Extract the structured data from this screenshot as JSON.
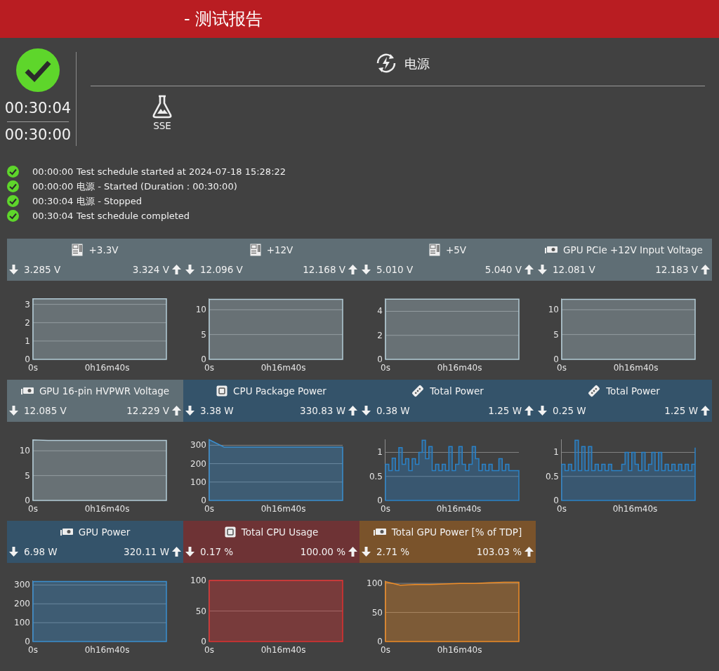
{
  "window": {
    "title": "- 测试报告"
  },
  "summary": {
    "passed": true,
    "elapsed": "00:30:04",
    "duration": "00:30:00"
  },
  "test": {
    "name": "电源"
  },
  "tests": [
    {
      "name": "SSE"
    }
  ],
  "log": [
    {
      "time": "00:00:00",
      "message": "Test schedule started at 2024-07-18 15:28:22"
    },
    {
      "time": "00:00:00",
      "message": "电源 - Started (Duration : 00:30:00)"
    },
    {
      "time": "00:30:04",
      "message": "电源 - Stopped"
    },
    {
      "time": "00:30:04",
      "message": "Test schedule completed"
    }
  ],
  "sensors": [
    {
      "kind": "board",
      "name": "+3.3V",
      "color": "#5f6e75",
      "min": "3.285 V",
      "max": "3.324 V",
      "chart_data": {
        "type": "area",
        "grid": true,
        "categories": [
          "0s",
          null,
          null,
          null,
          null,
          "0h16m40s",
          null,
          null,
          null,
          null
        ],
        "series": [
          {
            "color": "#b3cbd6",
            "values": [
              3.3,
              3.3,
              3.3,
              3.3,
              3.3,
              3.3,
              3.3,
              3.3,
              3.3,
              3.3
            ]
          }
        ],
        "ylim": [
          0,
          3.33
        ],
        "yticks": [
          0,
          1,
          2,
          3
        ]
      }
    },
    {
      "kind": "board",
      "name": "+12V",
      "color": "#5f6e75",
      "min": "12.096 V",
      "max": "12.168 V",
      "chart_data": {
        "type": "area",
        "grid": true,
        "categories": [
          "0s",
          null,
          null,
          null,
          null,
          "0h16m40s",
          null,
          null,
          null,
          null
        ],
        "series": [
          {
            "color": "#b3cbd6",
            "values": [
              12.1,
              12.1,
              12.1,
              12.1,
              12.1,
              12.1,
              12.1,
              12.1,
              12.1,
              12.1
            ]
          }
        ],
        "ylim": [
          0,
          12.3
        ],
        "yticks": [
          0,
          5,
          10
        ]
      }
    },
    {
      "kind": "board",
      "name": "+5V",
      "color": "#5f6e75",
      "min": "5.010 V",
      "max": "5.040 V",
      "chart_data": {
        "type": "area",
        "grid": true,
        "categories": [
          "0s",
          null,
          null,
          null,
          null,
          "0h16m40s",
          null,
          null,
          null,
          null
        ],
        "series": [
          {
            "color": "#b3cbd6",
            "values": [
              5.0,
              5.0,
              5.0,
              5.0,
              5.0,
              5.0,
              5.0,
              5.0,
              5.0,
              5.0
            ]
          }
        ],
        "ylim": [
          0,
          5.08
        ],
        "yticks": [
          0,
          2,
          4
        ]
      }
    },
    {
      "kind": "gpu",
      "name": "GPU PCIe +12V Input Voltage",
      "color": "#5f6e75",
      "min": "12.081 V",
      "max": "12.183 V",
      "chart_data": {
        "type": "area",
        "grid": true,
        "categories": [
          "0s",
          null,
          null,
          null,
          null,
          "0h16m40s",
          null,
          null,
          null,
          null
        ],
        "series": [
          {
            "color": "#b3cbd6",
            "values": [
              12.1,
              12.1,
              12.1,
              12.1,
              12.1,
              12.1,
              12.1,
              12.1,
              12.1,
              12.1
            ]
          }
        ],
        "ylim": [
          0,
          12.3
        ],
        "yticks": [
          0,
          5,
          10
        ]
      }
    },
    {
      "kind": "gpu",
      "name": "GPU 16-pin HVPWR Voltage",
      "color": "#5f6e75",
      "min": "12.085 V",
      "max": "12.229 V",
      "chart_data": {
        "type": "area",
        "grid": true,
        "categories": [
          "0s",
          null,
          null,
          null,
          null,
          "0h16m40s",
          null,
          null,
          null,
          null
        ],
        "series": [
          {
            "color": "#b3cbd6",
            "values": [
              12.2,
              12.1,
              12.1,
              12.1,
              12.1,
              12.1,
              12.1,
              12.1,
              12.1,
              12.1
            ]
          }
        ],
        "ylim": [
          0,
          12.3
        ],
        "yticks": [
          0,
          5,
          10
        ]
      }
    },
    {
      "kind": "cpu",
      "name": "CPU Package Power",
      "color": "#34536a",
      "min": "3.38 W",
      "max": "330.83 W",
      "chart_data": {
        "type": "area",
        "grid": true,
        "categories": [
          "0s",
          null,
          null,
          null,
          null,
          "0h16m40s",
          null,
          null,
          null,
          null
        ],
        "series": [
          {
            "color": "#3a8fd0",
            "values": [
              330,
              290,
              290,
              290,
              290,
              290,
              290,
              290,
              290,
              290
            ]
          }
        ],
        "ylim": [
          0,
          332
        ],
        "yticks": [
          0,
          100,
          200,
          300
        ]
      }
    },
    {
      "kind": "battery",
      "name": "Total Power",
      "color": "#34536a",
      "min": "0.38 W",
      "max": "1.25 W",
      "chart_data": {
        "type": "area",
        "grid": true,
        "categories": [
          "0s",
          null,
          null,
          null,
          null,
          null,
          null,
          null,
          null,
          null,
          null,
          null,
          null,
          null,
          null,
          null,
          null,
          null,
          null,
          null,
          null,
          null,
          "0h16m40s",
          null,
          null,
          null,
          null,
          null,
          null,
          null,
          null,
          null,
          null,
          null,
          null,
          null,
          null,
          null,
          null,
          null,
          null
        ],
        "series": [
          {
            "color": "#2a82c8",
            "values": [
              0.75,
              0.62,
              0.88,
              0.62,
              1.1,
              0.75,
              0.87,
              0.62,
              0.87,
              0.75,
              1.0,
              1.25,
              0.87,
              1.12,
              0.62,
              0.75,
              0.62,
              0.75,
              0.62,
              1.12,
              0.62,
              0.75,
              1.12,
              0.75,
              0.62,
              0.75,
              1.12,
              0.87,
              0.62,
              0.75,
              0.62,
              0.75,
              0.62,
              0.62,
              0.87,
              0.62,
              0.75,
              0.62,
              0.62,
              0.62,
              0.62
            ]
          }
        ],
        "ylim": [
          0,
          1.27
        ],
        "yticks": [
          0,
          0.5,
          1
        ]
      }
    },
    {
      "kind": "battery",
      "name": "Total Power",
      "color": "#34536a",
      "min": "0.25 W",
      "max": "1.25 W",
      "chart_data": {
        "type": "area",
        "grid": true,
        "categories": [
          "0s",
          null,
          null,
          null,
          null,
          null,
          null,
          null,
          null,
          null,
          null,
          null,
          null,
          null,
          null,
          null,
          null,
          null,
          null,
          null,
          null,
          null,
          "0h16m40s",
          null,
          null,
          null,
          null,
          null,
          null,
          null,
          null,
          null,
          null,
          null,
          null,
          null,
          null,
          null,
          null,
          null,
          null
        ],
        "series": [
          {
            "color": "#2a82c8",
            "values": [
              0.75,
              0.62,
              0.75,
              0.62,
              1.25,
              0.62,
              1.12,
              0.62,
              1.12,
              0.62,
              0.75,
              0.62,
              0.75,
              0.62,
              0.75,
              0.62,
              0.62,
              0.62,
              0.75,
              1.0,
              0.62,
              1.0,
              0.75,
              0.62,
              1.0,
              0.62,
              0.75,
              1.0,
              0.62,
              1.0,
              0.62,
              0.75,
              0.62,
              0.75,
              0.62,
              0.75,
              0.62,
              0.75,
              0.62,
              0.75,
              1.1
            ]
          }
        ],
        "ylim": [
          0,
          1.27
        ],
        "yticks": [
          0,
          0.5,
          1
        ]
      }
    },
    {
      "kind": "gpu",
      "name": "GPU Power",
      "color": "#34536a",
      "min": "6.98 W",
      "max": "320.11 W",
      "chart_data": {
        "type": "area",
        "grid": true,
        "categories": [
          "0s",
          null,
          null,
          null,
          null,
          "0h16m40s",
          null,
          null,
          null,
          null
        ],
        "series": [
          {
            "color": "#3a8fd0",
            "values": [
              318,
              318,
              318,
              318,
              318,
              318,
              318,
              318,
              318,
              318
            ]
          }
        ],
        "ylim": [
          0,
          324
        ],
        "yticks": [
          0,
          100,
          200,
          300
        ]
      }
    },
    {
      "kind": "cpu",
      "name": "Total CPU Usage",
      "color": "#6e3335",
      "min": "0.17 %",
      "max": "100.00 %",
      "chart_data": {
        "type": "area",
        "grid": true,
        "categories": [
          "0s",
          null,
          null,
          null,
          null,
          "0h16m40s",
          null,
          null,
          null,
          null
        ],
        "series": [
          {
            "color": "#e03131",
            "values": [
              100,
              100,
              100,
              100,
              100,
              100,
              100,
              100,
              100,
              100
            ]
          }
        ],
        "ylim": [
          0,
          100
        ],
        "yticks": [
          0,
          50,
          100
        ]
      }
    },
    {
      "kind": "gpu",
      "name": "Total GPU Power [% of TDP]",
      "color": "#7a532b",
      "min": "2.71 %",
      "max": "103.03 %",
      "chart_data": {
        "type": "area",
        "grid": true,
        "categories": [
          "0s",
          null,
          null,
          null,
          null,
          "0h16m40s",
          null,
          null,
          null,
          null
        ],
        "series": [
          {
            "color": "#ee8c26",
            "values": [
              103,
              97,
              98,
              98,
              99,
              100,
              100,
              101,
              102,
              102
            ]
          }
        ],
        "ylim": [
          0,
          105
        ],
        "yticks": [
          0,
          50,
          100
        ]
      }
    }
  ]
}
